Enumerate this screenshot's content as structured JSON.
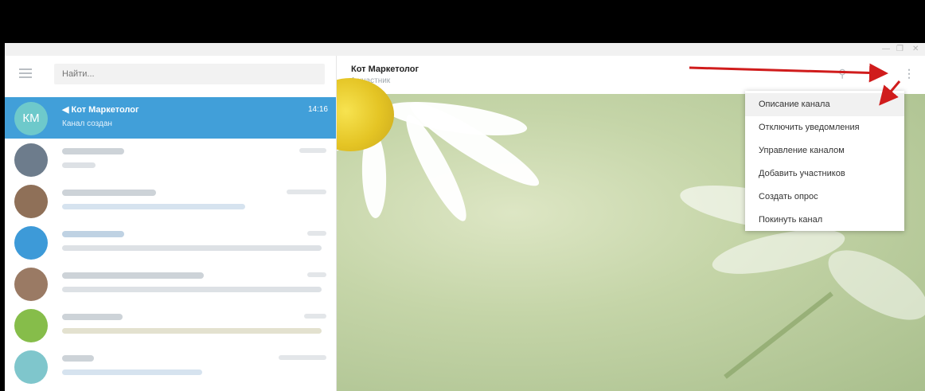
{
  "search": {
    "placeholder": "Найти..."
  },
  "active_chat": {
    "avatar_initials": "КМ",
    "name": "Кот Маркетолог",
    "time": "14:16",
    "preview": "Канал создан"
  },
  "channel": {
    "title": "Кот Маркетолог",
    "subtitle": "1 участник"
  },
  "menu": {
    "items": [
      "Описание канала",
      "Отключить уведомления",
      "Управление каналом",
      "Добавить участников",
      "Создать опрос",
      "Покинуть канал"
    ]
  },
  "colors": {
    "accent": "#419fd9",
    "arrow": "#d01c1c",
    "avatar_km": "#6ec9cb"
  },
  "icons": [
    "hamburger-icon",
    "megaphone-icon",
    "search-icon",
    "columns-icon",
    "more-vertical-icon"
  ]
}
